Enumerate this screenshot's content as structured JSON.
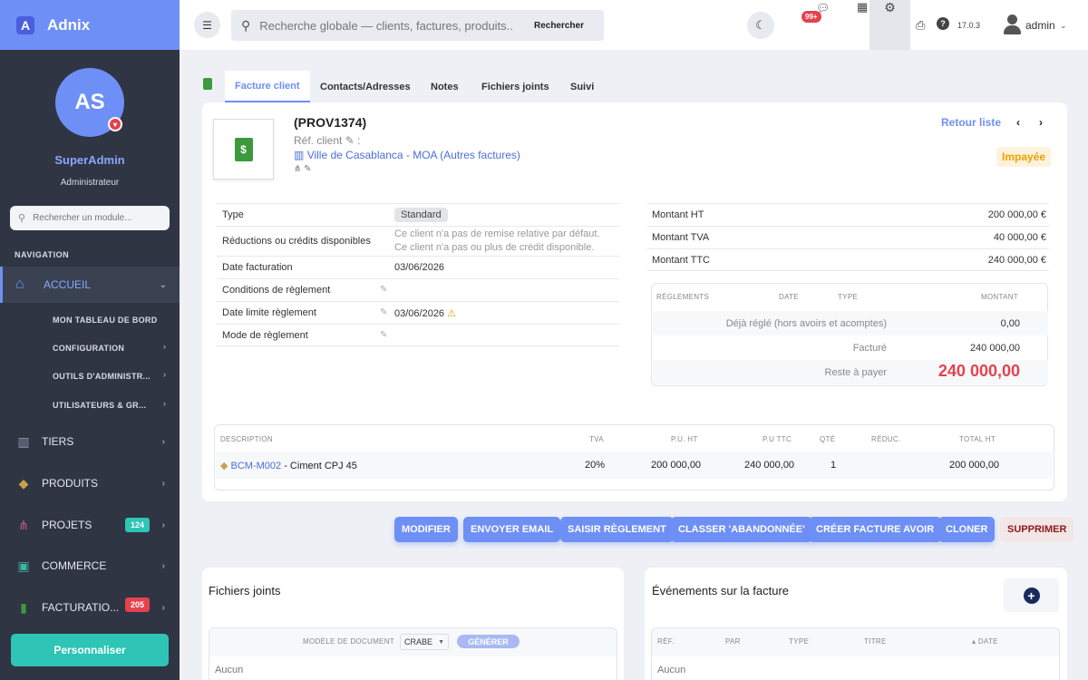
{
  "app": {
    "name": "Adnix",
    "logo_letter": "A"
  },
  "sidebar": {
    "avatar_initials": "AS",
    "user_name": "SuperAdmin",
    "user_role": "Administrateur",
    "module_search_placeholder": "Rechercher un module...",
    "nav_title": "NAVIGATION",
    "home": {
      "label": "ACCUEIL",
      "icon": "home-icon"
    },
    "subitems": [
      {
        "label": "MON TABLEAU DE BORD"
      },
      {
        "label": "CONFIGURATION"
      },
      {
        "label": "OUTILS D'ADMINISTR..."
      },
      {
        "label": "UTILISATEURS & GR..."
      }
    ],
    "items": [
      {
        "label": "TIERS",
        "icon": "building-icon"
      },
      {
        "label": "PRODUITS",
        "icon": "box-icon"
      },
      {
        "label": "PROJETS",
        "icon": "sitemap-icon",
        "badge": "124",
        "badge_color": "#2ec4b6"
      },
      {
        "label": "COMMERCE",
        "icon": "briefcase-icon"
      },
      {
        "label": "FACTURATIO...",
        "icon": "invoice-icon",
        "badge": "205",
        "badge_color": "#e3424f"
      }
    ],
    "personalize_label": "Personnaliser"
  },
  "topbar": {
    "search_placeholder": "Recherche globale — clients, factures, produits...",
    "search_button": "Rechercher",
    "chat_badge": "99+",
    "version": "17.0.3",
    "user": "admin"
  },
  "tabs": [
    {
      "label": "Facture client",
      "active": true
    },
    {
      "label": "Contacts/Adresses"
    },
    {
      "label": "Notes"
    },
    {
      "label": "Fichiers joints"
    },
    {
      "label": "Suivi"
    }
  ],
  "invoice": {
    "ref": "(PROV1374)",
    "ref_client_label": "Réf. client",
    "client": "Ville de Casablanca - MOA (Autres factures)",
    "back_to_list": "Retour liste",
    "status": "Impayée",
    "fields": [
      {
        "label": "Type",
        "value": "Standard"
      },
      {
        "label": "Réductions ou crédits disponibles",
        "value": "Ce client n'a pas de remise relative par défaut.",
        "value2": "Ce client n'a pas ou plus de crédit disponible."
      },
      {
        "label": "Date facturation",
        "value": "03/06/2026"
      },
      {
        "label": "Conditions de règlement",
        "value": ""
      },
      {
        "label": "Date limite règlement",
        "value": "03/06/2026"
      },
      {
        "label": "Mode de règlement",
        "value": ""
      }
    ],
    "amounts": [
      {
        "label": "Montant HT",
        "value": "200 000,00 €"
      },
      {
        "label": "Montant TVA",
        "value": "40 000,00 €"
      },
      {
        "label": "Montant TTC",
        "value": "240 000,00 €"
      }
    ],
    "payments": {
      "headers": [
        "RÈGLEMENTS",
        "DATE",
        "TYPE",
        "MONTANT"
      ],
      "rows": [
        {
          "label": "Déjà réglé (hors avoirs et acomptes)",
          "value": "0,00"
        },
        {
          "label": "Facturé",
          "value": "240 000,00"
        },
        {
          "label": "Reste à payer",
          "value": "240 000,00"
        }
      ]
    },
    "lines": {
      "headers": [
        "DESCRIPTION",
        "TVA",
        "P.U. HT",
        "P.U TTC",
        "QTÉ",
        "RÉDUC.",
        "TOTAL HT"
      ],
      "rows": [
        {
          "code": "BCM-M002",
          "label": " - Ciment CPJ 45",
          "tva": "20%",
          "pu_ht": "200 000,00",
          "pu_ttc": "240 000,00",
          "qty": "1",
          "reduc": "",
          "total": "200 000,00"
        }
      ]
    },
    "actions": [
      "MODIFIER",
      "ENVOYER EMAIL",
      "SAISIR RÈGLEMENT",
      "CLASSER 'ABANDONNÉE'",
      "CRÉER FACTURE AVOIR",
      "CLONER",
      "SUPPRIMER"
    ]
  },
  "files": {
    "title": "Fichiers joints",
    "model_label": "MODÈLE DE DOCUMENT",
    "model_value": "CRABE",
    "generate": "GÉNÉRER",
    "empty": "Aucun"
  },
  "events": {
    "title": "Événements sur la facture",
    "headers": [
      "RÉF.",
      "PAR",
      "TYPE",
      "TITRE",
      "DATE"
    ],
    "empty": "Aucun"
  }
}
